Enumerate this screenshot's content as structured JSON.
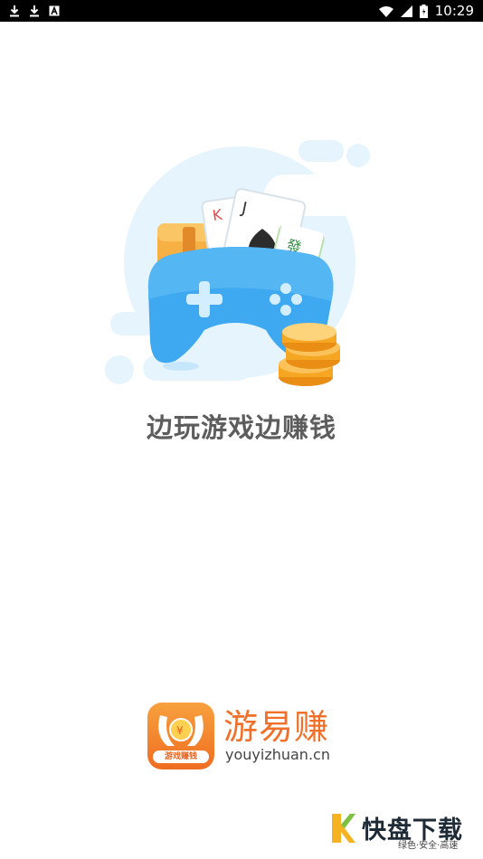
{
  "status_bar": {
    "icons_left": [
      "download-icon",
      "download-icon",
      "a-box-icon"
    ],
    "time": "10:29"
  },
  "splash": {
    "tagline": "边玩游戏边赚钱"
  },
  "brand": {
    "icon_label": "游戏赚钱",
    "name": "游易赚",
    "url": "youyizhuan.cn",
    "colors": {
      "primary": "#f07029",
      "accent": "#f7a13e"
    }
  },
  "watermark": {
    "text": "快盘下载",
    "subtitle": "绿色·安全·高速"
  }
}
